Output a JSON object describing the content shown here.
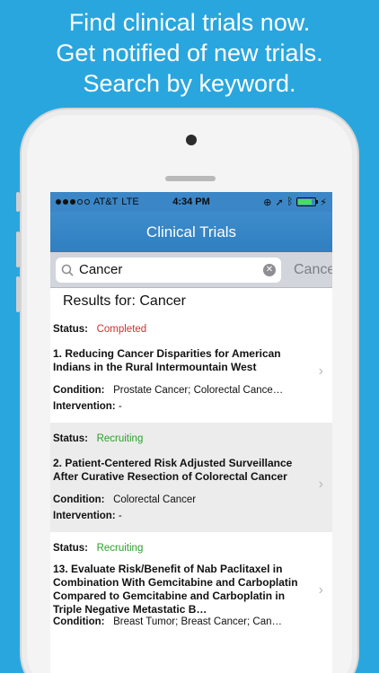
{
  "promo": {
    "line1": "Find clinical trials now.",
    "line2": "Get notified of new trials.",
    "line3": "Search by keyword."
  },
  "status_bar": {
    "carrier": "AT&T",
    "network": "LTE",
    "time": "4:34 PM"
  },
  "nav": {
    "title": "Clinical Trials"
  },
  "search": {
    "value": "Cancer",
    "cancel_label": "Cancel"
  },
  "results": {
    "header": "Results for: Cancer",
    "status_label": "Status:",
    "condition_label": "Condition:",
    "intervention_label": "Intervention:",
    "items": [
      {
        "status": "Completed",
        "title": "1. Reducing Cancer Disparities for American Indians in the Rural Intermountain West",
        "condition": "Prostate Cancer; Colorectal Cance…",
        "intervention": "-"
      },
      {
        "status": "Recruiting",
        "title": "2. Patient-Centered Risk Adjusted Surveillance After Curative Resection of Colorectal Cancer",
        "condition": "Colorectal Cancer",
        "intervention": "-"
      },
      {
        "status": "Recruiting",
        "title": "13. Evaluate Risk/Benefit of Nab Paclitaxel in Combination With Gemcitabine and Carboplatin Compared to Gemcitabine and Carboplatin in Triple Negative Metastatic B…",
        "condition": "Breast Tumor; Breast Cancer; Can…",
        "intervention": ""
      }
    ]
  },
  "colors": {
    "background": "#2aa6de",
    "nav": "#2f7fc1",
    "completed": "#d0312d",
    "recruiting": "#2aa12a"
  },
  "tabs": [
    {
      "icon": "search-icon"
    },
    {
      "icon": "star-icon"
    },
    {
      "icon": "bookmark-icon"
    }
  ]
}
